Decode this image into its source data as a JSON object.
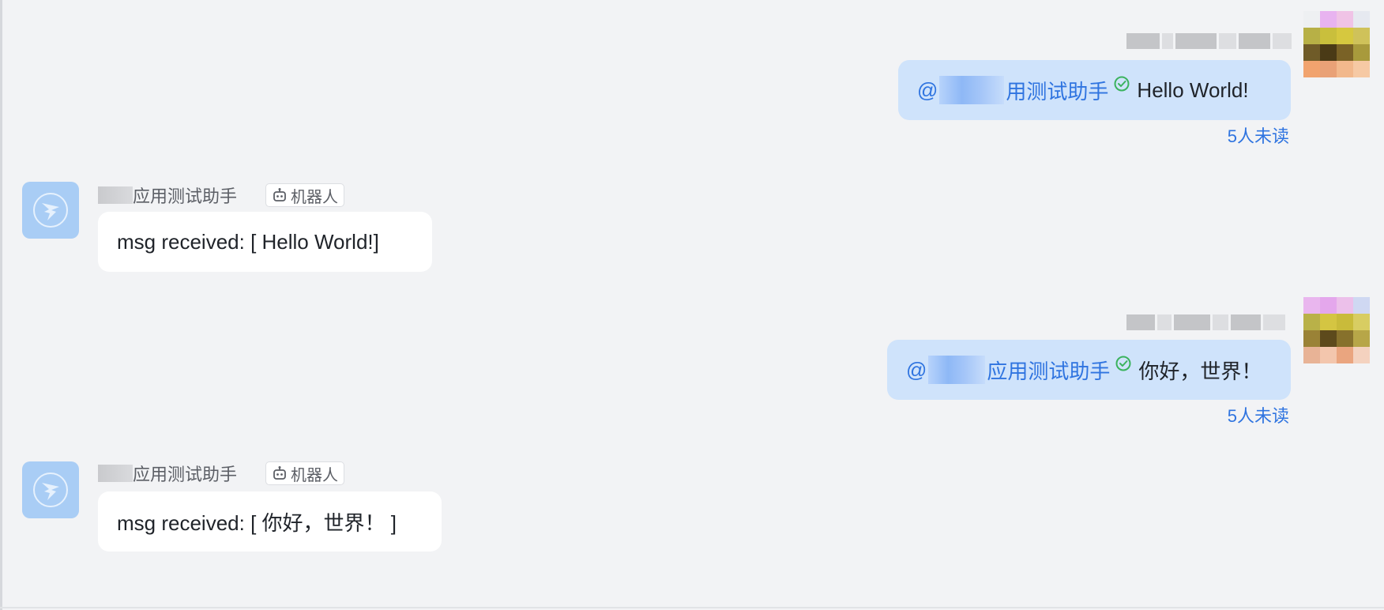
{
  "colors": {
    "background": "#f2f3f5",
    "outgoing_bubble": "#cfe3fb",
    "incoming_bubble": "#ffffff",
    "link_blue": "#2f74e0",
    "verified_green": "#3bb35e",
    "bot_avatar": "#a9cdf5"
  },
  "messages": [
    {
      "direction": "outgoing",
      "mention_prefix": "@",
      "mention_name": "用测试助手",
      "text": "Hello World!",
      "unread": "5人未读",
      "avatar_icon": "user-avatar-pixelated",
      "verified_icon": "check-circle-icon"
    },
    {
      "direction": "incoming",
      "sender_name": "应用测试助手",
      "tag": "机器人",
      "tag_icon": "robot-icon",
      "text": "msg received: [ Hello World!]",
      "avatar_icon": "dingtalk-logo-icon"
    },
    {
      "direction": "outgoing",
      "mention_prefix": "@",
      "mention_name": "应用测试助手",
      "text": "你好，世界！",
      "unread": "5人未读",
      "avatar_icon": "user-avatar-pixelated",
      "verified_icon": "check-circle-icon"
    },
    {
      "direction": "incoming",
      "sender_name": "应用测试助手",
      "tag": "机器人",
      "tag_icon": "robot-icon",
      "text": "msg received: [ 你好，世界！ ]",
      "avatar_icon": "dingtalk-logo-icon"
    }
  ]
}
